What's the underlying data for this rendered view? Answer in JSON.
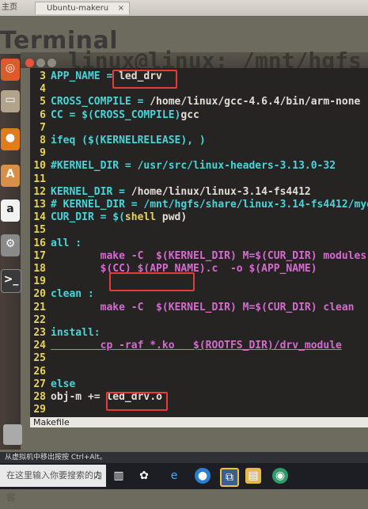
{
  "browser_tabs": [
    {
      "label": "主页"
    },
    {
      "label": "Ubuntu-makeru"
    }
  ],
  "heading": "Terminal",
  "window_title": "linux@linux: /mnt/hgfs",
  "file_label": "Makefile",
  "hint_text": "从虚拟机中移出按按 Ctrl+Alt。",
  "search_placeholder": "在这里输入你要搜索的内容",
  "launcher_icons": [
    "ubuntu-dash-icon",
    "files-icon",
    "firefox-icon",
    "software-center-icon",
    "amazon-icon",
    "settings-icon",
    "terminal-icon"
  ],
  "lines": [
    {
      "num": "3",
      "parts": [
        {
          "t": "APP_NAME = ",
          "c": "c-var"
        },
        {
          "t": "led_drv",
          "c": "c-white"
        }
      ]
    },
    {
      "num": "4",
      "parts": []
    },
    {
      "num": "5",
      "parts": [
        {
          "t": "CROSS_COMPILE = ",
          "c": "c-var"
        },
        {
          "t": "/home/linux/gcc-4.6.4/bin/arm-none",
          "c": "c-white"
        }
      ]
    },
    {
      "num": "6",
      "parts": [
        {
          "t": "CC = $(CROSS_COMPILE)",
          "c": "c-var"
        },
        {
          "t": "gcc",
          "c": "c-white"
        }
      ]
    },
    {
      "num": "7",
      "parts": []
    },
    {
      "num": "8",
      "parts": [
        {
          "t": "ifeq ($(KERNELRELEASE), )",
          "c": "c-var"
        }
      ]
    },
    {
      "num": "9",
      "parts": []
    },
    {
      "num": "10",
      "parts": [
        {
          "t": "#KERNEL_DIR = /usr/src/linux-headers-3.13.0-32",
          "c": "c-var"
        }
      ]
    },
    {
      "num": "11",
      "parts": []
    },
    {
      "num": "12",
      "parts": [
        {
          "t": "KERNEL_DIR = ",
          "c": "c-var"
        },
        {
          "t": "/home/linux/linux-3.14-fs4412",
          "c": "c-white"
        }
      ]
    },
    {
      "num": "13",
      "parts": [
        {
          "t": "# KERNEL_DIR = /mnt/hgfs/share/linux-3.14-fs4412/myo",
          "c": "c-var"
        }
      ]
    },
    {
      "num": "14",
      "parts": [
        {
          "t": "CUR_DIR = $(",
          "c": "c-var"
        },
        {
          "t": "shell",
          "c": "c-yel"
        },
        {
          "t": " pwd)",
          "c": "c-white"
        }
      ]
    },
    {
      "num": "15",
      "parts": []
    },
    {
      "num": "16",
      "parts": [
        {
          "t": "all :",
          "c": "c-var"
        }
      ]
    },
    {
      "num": "17",
      "parts": [
        {
          "t": "        make -C  $(KERNEL_DIR) M=$(CUR_DIR) modules",
          "c": "c-kw"
        }
      ]
    },
    {
      "num": "18",
      "parts": [
        {
          "t": "        $(CC) ",
          "c": "c-kw"
        },
        {
          "t": "$(APP_NAME).c",
          "c": "c-kw"
        },
        {
          "t": "  -o $(APP_NAME)",
          "c": "c-kw"
        }
      ]
    },
    {
      "num": "19",
      "parts": []
    },
    {
      "num": "20",
      "parts": [
        {
          "t": "clean :",
          "c": "c-var"
        }
      ]
    },
    {
      "num": "21",
      "parts": [
        {
          "t": "        make -C  $(KERNEL_DIR) M=$(CUR_DIR) clean",
          "c": "c-kw"
        }
      ]
    },
    {
      "num": "22",
      "parts": []
    },
    {
      "num": "23",
      "parts": [
        {
          "t": "install:",
          "c": "c-var"
        }
      ]
    },
    {
      "num": "24",
      "parts": [
        {
          "t": "        cp -raf *.ko   $(ROOTFS_DIR)/drv_module",
          "c": "c-kw"
        }
      ]
    },
    {
      "num": "25",
      "parts": []
    },
    {
      "num": "26",
      "parts": []
    },
    {
      "num": "27",
      "parts": [
        {
          "t": "else",
          "c": "c-var"
        }
      ]
    },
    {
      "num": "28",
      "parts": [
        {
          "t": "obj-m += ",
          "c": "c-white"
        },
        {
          "t": "led_drv.o",
          "c": "c-white"
        }
      ]
    },
    {
      "num": "29",
      "parts": []
    }
  ]
}
